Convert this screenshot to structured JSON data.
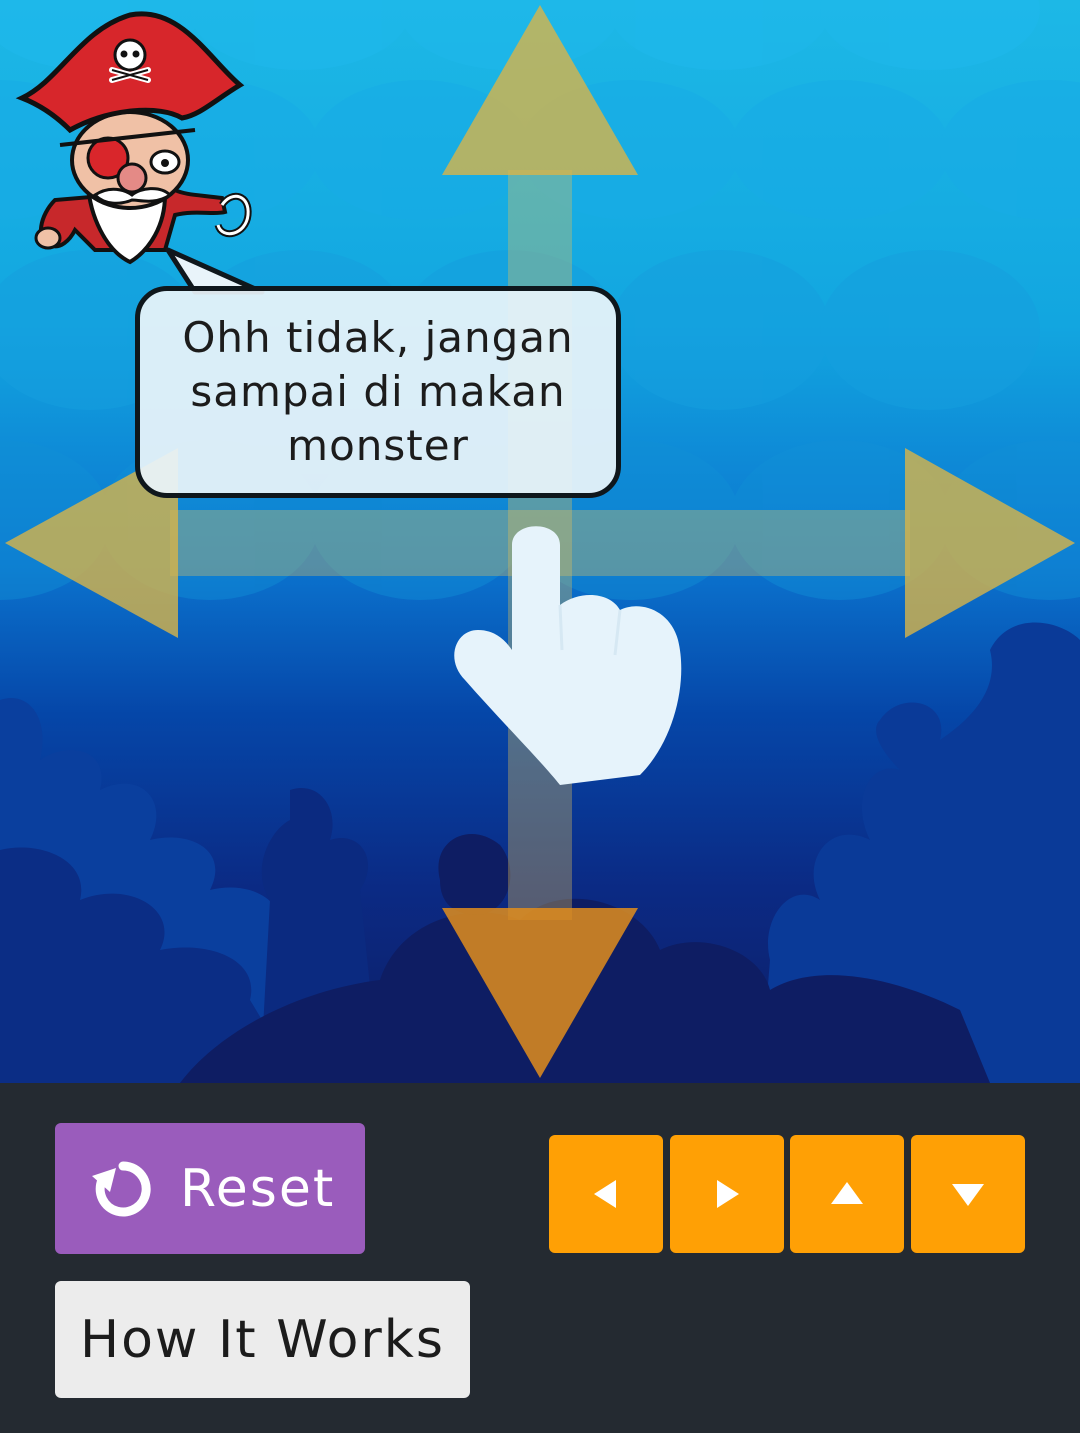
{
  "game": {
    "dialog": {
      "text": "Ohh tidak, jangan sampai di makan monster"
    }
  },
  "controls": {
    "reset_label": "Reset",
    "how_it_works_label": "How It Works",
    "arrow_buttons": [
      "left",
      "right",
      "up",
      "down"
    ]
  },
  "colors": {
    "reset_button": "#9a5cbc",
    "arrow_button": "#ffa005",
    "panel_background": "#242a31",
    "how_button": "#ececec"
  },
  "icons": {
    "reset": "refresh-icon",
    "hand": "pointing-hand-icon",
    "character": "pirate-icon"
  }
}
